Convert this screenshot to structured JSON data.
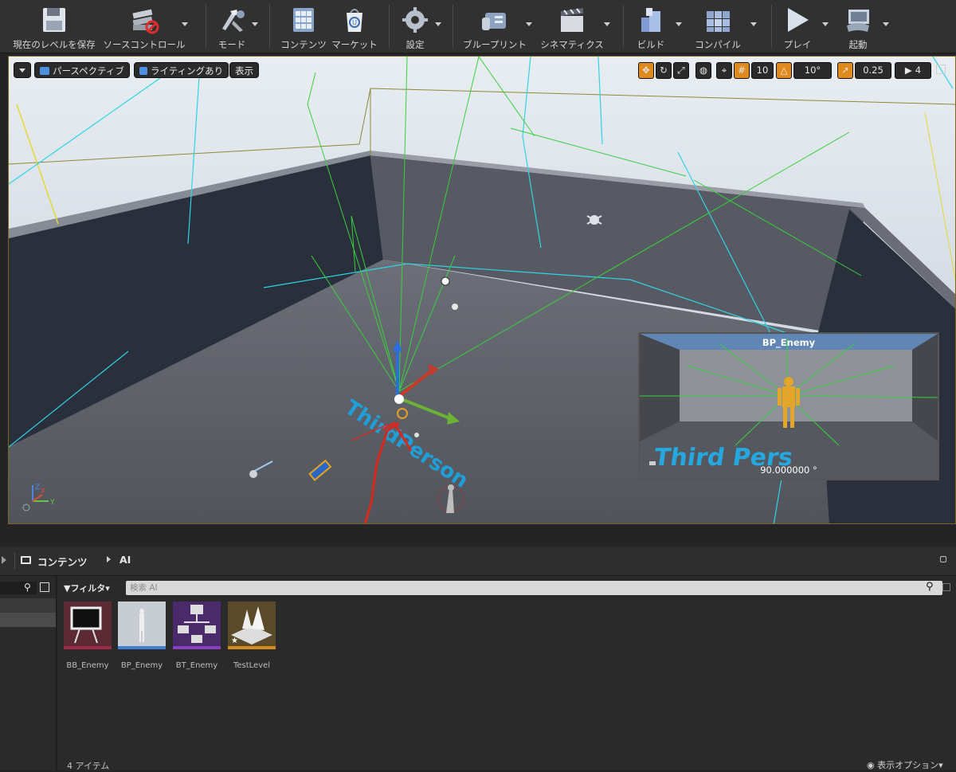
{
  "toolbar": {
    "items": [
      {
        "label": "現在のレベルを保存",
        "icon": "save-icon"
      },
      {
        "label": "ソースコントロール",
        "icon": "source-control-icon"
      },
      {
        "label": "モード",
        "icon": "modes-icon"
      },
      {
        "label": "コンテンツ",
        "icon": "content-icon"
      },
      {
        "label": "マーケット",
        "icon": "marketplace-icon"
      },
      {
        "label": "設定",
        "icon": "settings-gear-icon"
      },
      {
        "label": "ブループリント",
        "icon": "blueprint-icon"
      },
      {
        "label": "シネマティクス",
        "icon": "cinematics-icon"
      },
      {
        "label": "ビルド",
        "icon": "build-icon"
      },
      {
        "label": "コンパイル",
        "icon": "compile-icon"
      },
      {
        "label": "プレイ",
        "icon": "play-icon"
      },
      {
        "label": "起動",
        "icon": "launch-icon"
      }
    ]
  },
  "viewport": {
    "perspective_label": "パースペクティブ",
    "lighting_label": "ライティングあり",
    "show_label": "表示",
    "grid_snap": "10",
    "rotation_snap": "10°",
    "scale_snap": "0.25",
    "camera_speed": "4",
    "floor_text": "ThirdPerson",
    "axis_x": "X",
    "axis_y": "Y",
    "axis_z": "Z"
  },
  "preview": {
    "title": "BP_Enemy",
    "angle": "90.000000 °",
    "floor_text": "Third Pers"
  },
  "content_browser": {
    "breadcrumb_root": "コンテンツ",
    "breadcrumb_current": "AI",
    "filter_label": "フィルタ",
    "search_placeholder": "検索 AI",
    "assets": [
      {
        "name": "BB_Enemy",
        "type_color": "#9c2843"
      },
      {
        "name": "BP_Enemy",
        "type_color": "#3f7fd8"
      },
      {
        "name": "BT_Enemy",
        "type_color": "#8a3ec0"
      },
      {
        "name": "TestLevel",
        "type_color": "#d48a1c"
      }
    ],
    "item_count": "4 アイテム",
    "view_options": "表示オプション"
  },
  "colors": {
    "annotation": "#d8281e",
    "accent": "#e08a1d"
  }
}
